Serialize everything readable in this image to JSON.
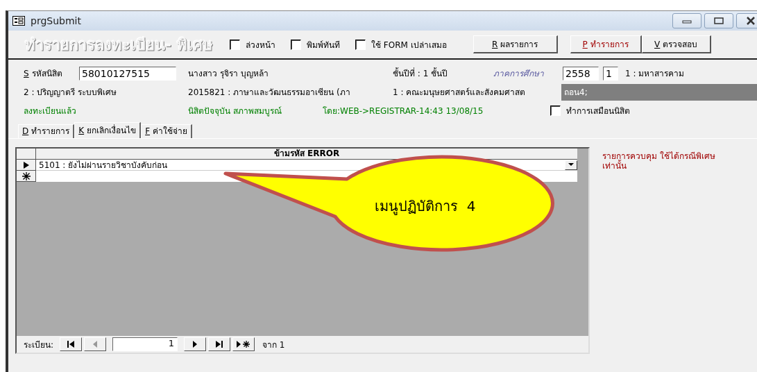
{
  "window": {
    "title": "prgSubmit"
  },
  "heading": "ทำรายการลงทะเบียน- พิเศษ",
  "options": [
    {
      "label": "ล่วงหน้า",
      "checked": false
    },
    {
      "label": "พิมพ์ทันที",
      "checked": false
    },
    {
      "label": "ใช้ FORM เปล่าเสมอ",
      "checked": false
    }
  ],
  "buttons": [
    {
      "hotkey": "R",
      "label": "ผลรายการ",
      "kind": "normal"
    },
    {
      "hotkey": "P",
      "label": "ทำรายการ",
      "kind": "accent"
    },
    {
      "hotkey": "V",
      "label": "ตรวจสอบ",
      "kind": "normal"
    }
  ],
  "student": {
    "id_hotkey": "S",
    "id_label": "รหัสนิสิต",
    "id": "58010127515",
    "name": "นางสาว รุจิรา  บุญหล้า",
    "year": "ชั้นปีที่ : 1 ชั้นปี",
    "term_label": "ภาคการศึกษา",
    "term_year": "2558",
    "term": "1",
    "campus": "1 : มหาสารคาม",
    "degree": "2 : ปริญญาตรี ระบบพิเศษ",
    "program": "2015821 : ภาษาและวัฒนธรรมอาเซียน (ภา",
    "faculty": "1 : คณะมนุษยศาสตร์และสังคมศาสต",
    "note": "ถอน4;",
    "status": "ลงทะเบียนแล้ว",
    "standing": "นิสิตปัจจุบัน สภาพสมบูรณ์",
    "by": "โดย:WEB->REGISTRAR-14:43 13/08/15",
    "impersonate": {
      "label": "ทำการเสมือนนิสิต",
      "checked": false
    }
  },
  "tabs": [
    {
      "hotkey": "D",
      "label": "ทำรายการ",
      "selected": false
    },
    {
      "hotkey": "K",
      "label": "ยกเลิกเงื่อนไข",
      "selected": true
    },
    {
      "hotkey": "F",
      "label": "ค่าใช้จ่าย",
      "selected": false
    }
  ],
  "grid": {
    "column": "ข้ามรหัส ERROR",
    "rows": [
      {
        "value": "5101 : ยังไม่ผ่านรายวิชาบังคับก่อน",
        "current": true
      }
    ]
  },
  "navigator": {
    "label": "ระเบียน:",
    "record": "1",
    "total": "จาก 1"
  },
  "side_note": "รายการควบคุม ใช้ได้กรณีพิเศษเท่านั้น",
  "callout": {
    "text": "เมนูปฏิบัติการ  4"
  }
}
